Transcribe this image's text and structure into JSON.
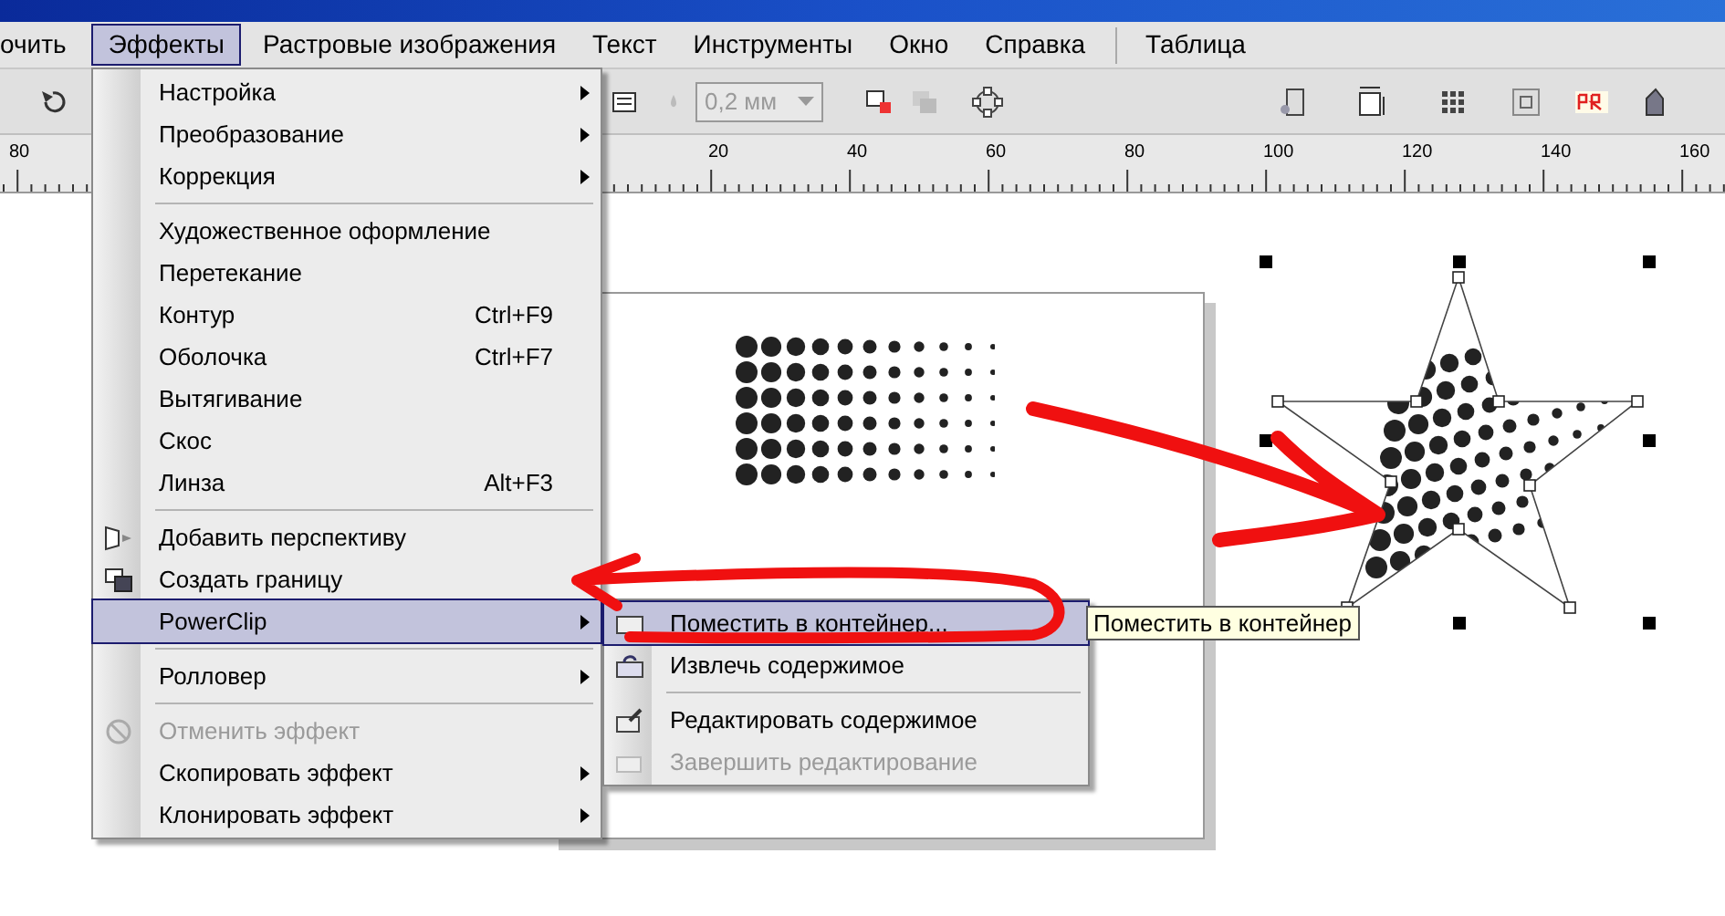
{
  "menubar": [
    {
      "kind": "item",
      "label": "очить",
      "selected": false
    },
    {
      "kind": "item",
      "label": "Эффекты",
      "selected": true
    },
    {
      "kind": "item",
      "label": "Растровые изображения",
      "selected": false
    },
    {
      "kind": "item",
      "label": "Текст",
      "selected": false
    },
    {
      "kind": "item",
      "label": "Инструменты",
      "selected": false
    },
    {
      "kind": "item",
      "label": "Окно",
      "selected": false
    },
    {
      "kind": "item",
      "label": "Справка",
      "selected": false
    },
    {
      "kind": "separator"
    },
    {
      "kind": "item",
      "label": "Таблица",
      "selected": false
    }
  ],
  "toolbar": {
    "outline_width": {
      "value": "0,2 мм",
      "disabled": true
    }
  },
  "ruler": {
    "labels": [
      "80",
      "20",
      "40",
      "60",
      "80",
      "100",
      "120",
      "140",
      "160"
    ]
  },
  "effects_menu": {
    "items": [
      {
        "kind": "item",
        "label": "Настройка",
        "submenu": true,
        "disabled": false,
        "selected": false
      },
      {
        "kind": "item",
        "label": "Преобразование",
        "submenu": true,
        "disabled": false,
        "selected": false
      },
      {
        "kind": "item",
        "label": "Коррекция",
        "submenu": true,
        "disabled": false,
        "selected": false
      },
      {
        "kind": "separator"
      },
      {
        "kind": "item",
        "label": "Художественное оформление",
        "submenu": false,
        "disabled": false,
        "selected": false
      },
      {
        "kind": "item",
        "label": "Перетекание",
        "submenu": false,
        "disabled": false,
        "selected": false
      },
      {
        "kind": "item",
        "label": "Контур",
        "shortcut": "Ctrl+F9",
        "submenu": false,
        "disabled": false,
        "selected": false
      },
      {
        "kind": "item",
        "label": "Оболочка",
        "shortcut": "Ctrl+F7",
        "submenu": false,
        "disabled": false,
        "selected": false
      },
      {
        "kind": "item",
        "label": "Вытягивание",
        "submenu": false,
        "disabled": false,
        "selected": false
      },
      {
        "kind": "item",
        "label": "Скос",
        "submenu": false,
        "disabled": false,
        "selected": false
      },
      {
        "kind": "item",
        "label": "Линза",
        "shortcut": "Alt+F3",
        "submenu": false,
        "disabled": false,
        "selected": false
      },
      {
        "kind": "separator"
      },
      {
        "kind": "item",
        "label": "Добавить перспективу",
        "submenu": false,
        "disabled": false,
        "selected": false
      },
      {
        "kind": "item",
        "label": "Создать границу",
        "submenu": false,
        "disabled": false,
        "selected": false
      },
      {
        "kind": "item",
        "label": "PowerClip",
        "submenu": true,
        "disabled": false,
        "selected": true
      },
      {
        "kind": "separator"
      },
      {
        "kind": "item",
        "label": "Ролловер",
        "submenu": true,
        "disabled": false,
        "selected": false
      },
      {
        "kind": "separator"
      },
      {
        "kind": "item",
        "label": "Отменить эффект",
        "submenu": false,
        "disabled": true,
        "selected": false
      },
      {
        "kind": "item",
        "label": "Скопировать эффект",
        "submenu": true,
        "disabled": false,
        "selected": false
      },
      {
        "kind": "item",
        "label": "Клонировать эффект",
        "submenu": true,
        "disabled": false,
        "selected": false
      }
    ]
  },
  "powerclip_submenu": {
    "items": [
      {
        "kind": "item",
        "label": "Поместить в контейнер...",
        "disabled": false,
        "selected": true
      },
      {
        "kind": "item",
        "label": "Извлечь содержимое",
        "disabled": false,
        "selected": false
      },
      {
        "kind": "separator"
      },
      {
        "kind": "item",
        "label": "Редактировать содержимое",
        "disabled": false,
        "selected": false
      },
      {
        "kind": "item",
        "label": "Завершить редактирование",
        "disabled": true,
        "selected": false
      }
    ]
  },
  "tooltip": "Поместить в контейнер"
}
